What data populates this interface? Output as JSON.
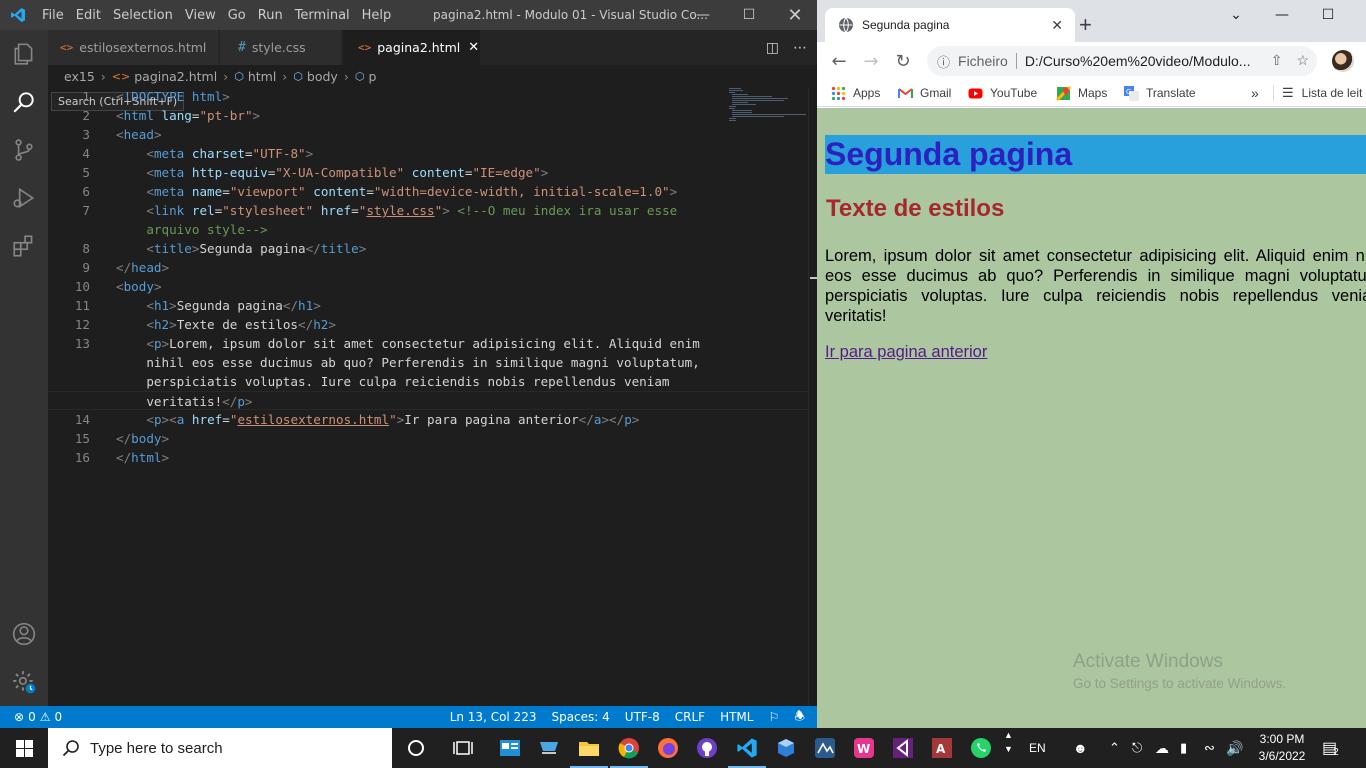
{
  "vscode": {
    "menu": [
      "File",
      "Edit",
      "Selection",
      "View",
      "Go",
      "Run",
      "Terminal",
      "Help"
    ],
    "window_title": "pagina2.html - Modulo 01 - Visual Studio Co...",
    "search_tooltip": "Search (Ctrl+Shift+F)",
    "tabs": [
      {
        "label": "estilosexternos.html",
        "icon": "<>"
      },
      {
        "label": "style.css",
        "icon": "#"
      },
      {
        "label": "pagina2.html",
        "icon": "<>"
      }
    ],
    "breadcrumb": [
      "ex15",
      "pagina2.html",
      "html",
      "body",
      "p"
    ],
    "code_lines": [
      {
        "n": "1",
        "text": "<!DOCTYPE html>"
      },
      {
        "n": "2",
        "text": "<html lang=\"pt-br\">"
      },
      {
        "n": "3",
        "text": "<head>"
      },
      {
        "n": "4",
        "text": "    <meta charset=\"UTF-8\">"
      },
      {
        "n": "5",
        "text": "    <meta http-equiv=\"X-UA-Compatible\" content=\"IE=edge\">"
      },
      {
        "n": "6",
        "text": "    <meta name=\"viewport\" content=\"width=device-width, initial-scale=1.0\">"
      },
      {
        "n": "7",
        "text": "    <link rel=\"stylesheet\" href=\"style.css\"> <!--O meu index ira usar esse"
      },
      {
        "n": "",
        "text": "    arquivo style-->"
      },
      {
        "n": "8",
        "text": "    <title>Segunda pagina</title>"
      },
      {
        "n": "9",
        "text": "</head>"
      },
      {
        "n": "10",
        "text": "<body>"
      },
      {
        "n": "11",
        "text": "    <h1>Segunda pagina</h1>"
      },
      {
        "n": "12",
        "text": "    <h2>Texte de estilos</h2>"
      },
      {
        "n": "13",
        "text": "    <p>Lorem, ipsum dolor sit amet consectetur adipisicing elit. Aliquid enim"
      },
      {
        "n": "",
        "text": "    nihil eos esse ducimus ab quo? Perferendis in similique magni voluptatum,"
      },
      {
        "n": "",
        "text": "    perspiciatis voluptas. Iure culpa reiciendis nobis repellendus veniam"
      },
      {
        "n": "",
        "text": "    veritatis!</p>"
      },
      {
        "n": "14",
        "text": "    <p><a href=\"estilosexternos.html\">Ir para pagina anterior</a></p>"
      },
      {
        "n": "15",
        "text": "</body>"
      },
      {
        "n": "16",
        "text": "</html>"
      }
    ],
    "status": {
      "errors": "0",
      "warnings": "0",
      "position": "Ln 13, Col 223",
      "spaces": "Spaces: 4",
      "encoding": "UTF-8",
      "eol": "CRLF",
      "language": "HTML"
    }
  },
  "chrome": {
    "tab_title": "Segunda pagina",
    "address_prefix": "Ficheiro",
    "address": "D:/Curso%20em%20video/Modulo...",
    "bookmarks": [
      "Apps",
      "Gmail",
      "YouTube",
      "Maps",
      "Translate"
    ],
    "reading_list": "Lista de leit",
    "page": {
      "h1": "Segunda pagina",
      "h2": "Texte de estilos",
      "paragraph": "Lorem, ipsum dolor sit amet consectetur adipisicing elit. Aliquid enim nihil eos esse ducimus ab quo? Perferendis in similique magni voluptatum, perspiciatis voluptas. Iure culpa reiciendis nobis repellendus veniam veritatis!",
      "link": "Ir para pagina anterior"
    },
    "watermark_title": "Activate Windows",
    "watermark_sub": "Go to Settings to activate Windows."
  },
  "taskbar": {
    "search_placeholder": "Type here to search",
    "language": "EN",
    "time": "3:00 PM",
    "date": "3/6/2022",
    "notifications": "2"
  },
  "colors": {
    "vscode_bg": "#1e1e1e",
    "statusbar": "#007acc",
    "page_bg": "#acc6a0",
    "h1_bg": "#27a0dc",
    "h1_text": "#2c20c0",
    "h2_text": "#a5282f"
  }
}
